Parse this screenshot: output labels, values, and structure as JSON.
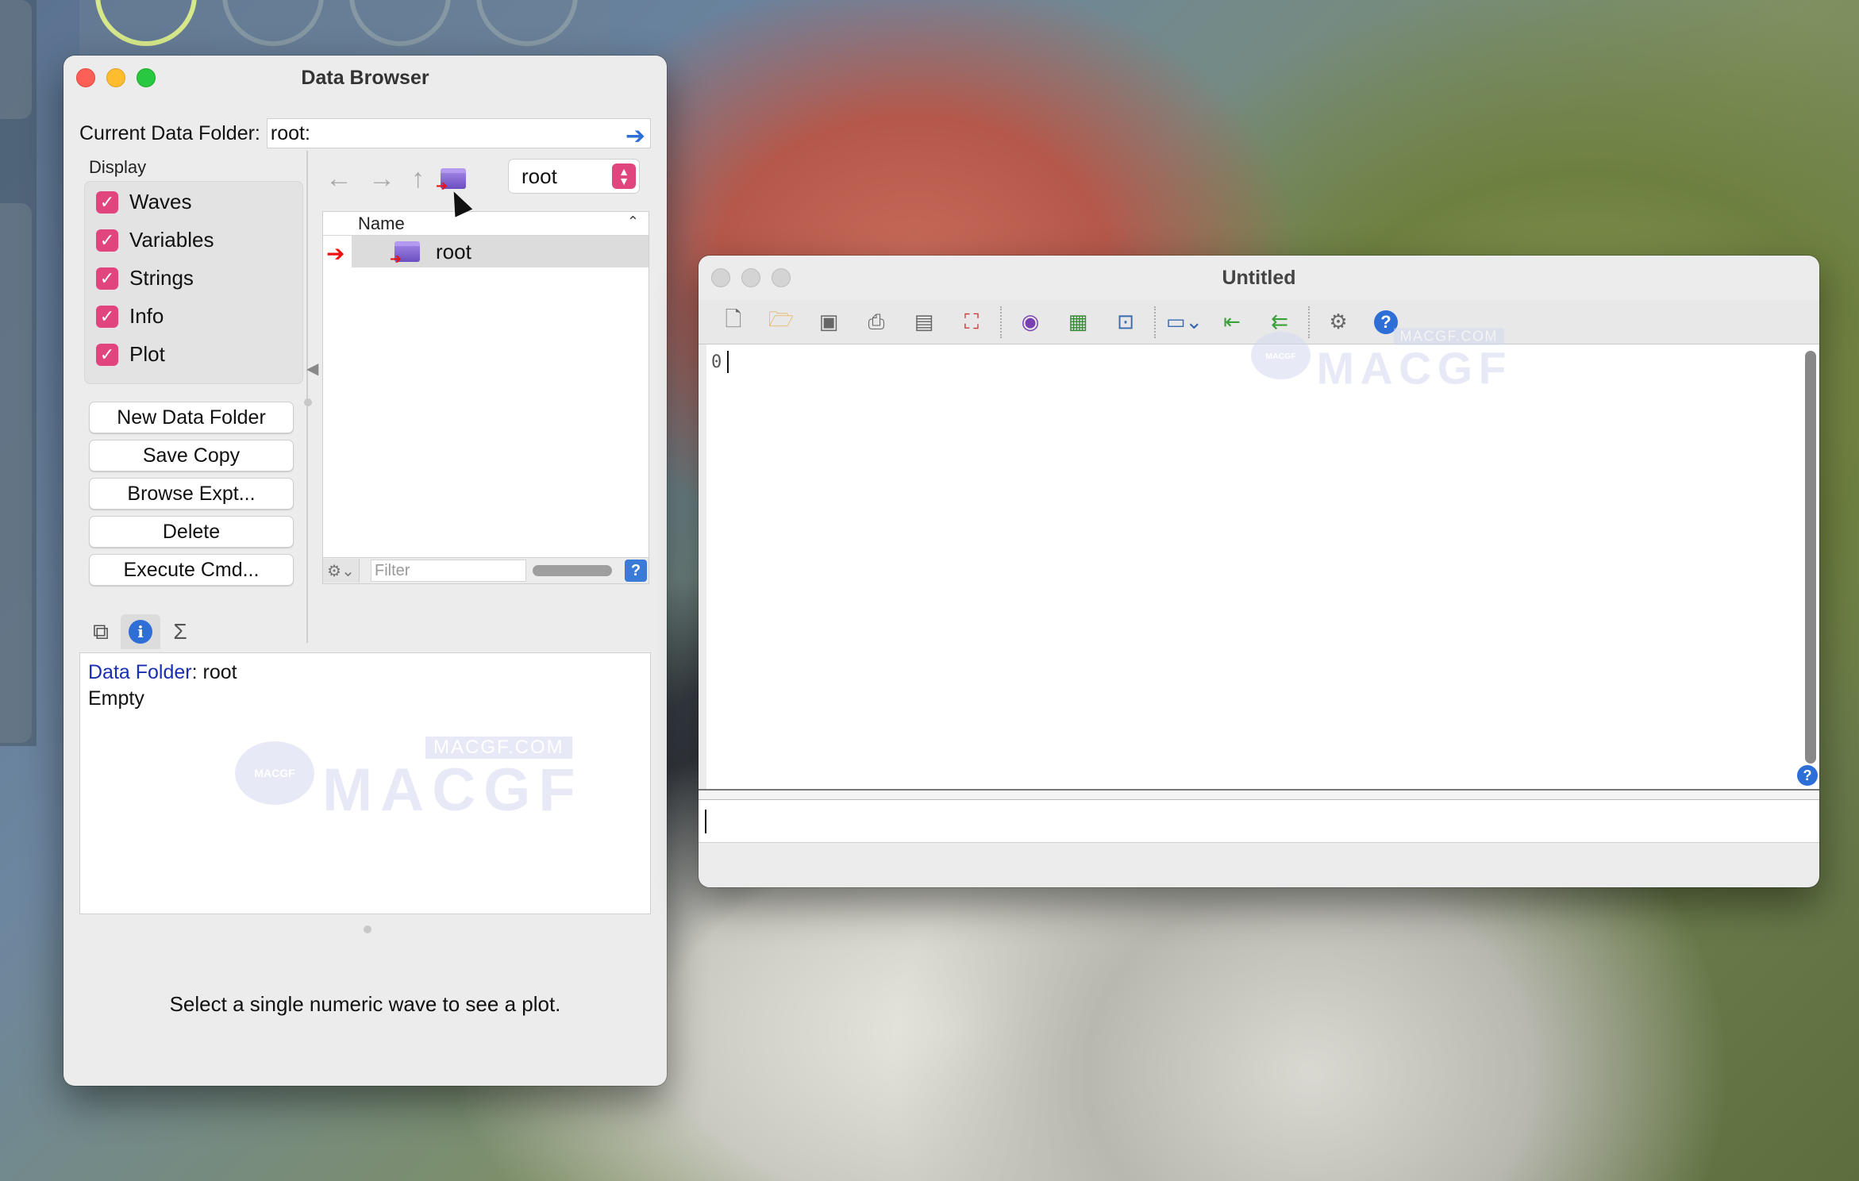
{
  "data_browser": {
    "title": "Data Browser",
    "current_folder_label": "Current Data Folder:",
    "current_folder_value": "root:",
    "display_label": "Display",
    "checkboxes": [
      {
        "label": "Waves",
        "checked": true
      },
      {
        "label": "Variables",
        "checked": true
      },
      {
        "label": "Strings",
        "checked": true
      },
      {
        "label": "Info",
        "checked": true
      },
      {
        "label": "Plot",
        "checked": true
      }
    ],
    "buttons": {
      "new_folder": "New Data Folder",
      "save_copy": "Save Copy",
      "browse_expt": "Browse Expt...",
      "delete": "Delete",
      "execute_cmd": "Execute Cmd..."
    },
    "folder_popup": "root",
    "list_header": "Name",
    "list_items": [
      "root"
    ],
    "filter_placeholder": "Filter",
    "info": {
      "key": "Data Folder",
      "value": ": root",
      "line2": "Empty"
    },
    "plot_message": "Select a single numeric wave to see a plot."
  },
  "untitled": {
    "title": "Untitled",
    "notebook_first_line": "0"
  },
  "watermark": {
    "url": "MACGF.COM",
    "brand": "MACGF",
    "badge": "MACGF"
  },
  "colors": {
    "accent_checkbox": "#e0457e",
    "link_blue": "#2d6fd6",
    "info_key": "#1a2fb0"
  },
  "icons": {
    "back": "arrow-left-icon",
    "forward": "arrow-right-icon",
    "up": "arrow-up-icon",
    "go": "arrow-right-blue-icon"
  }
}
